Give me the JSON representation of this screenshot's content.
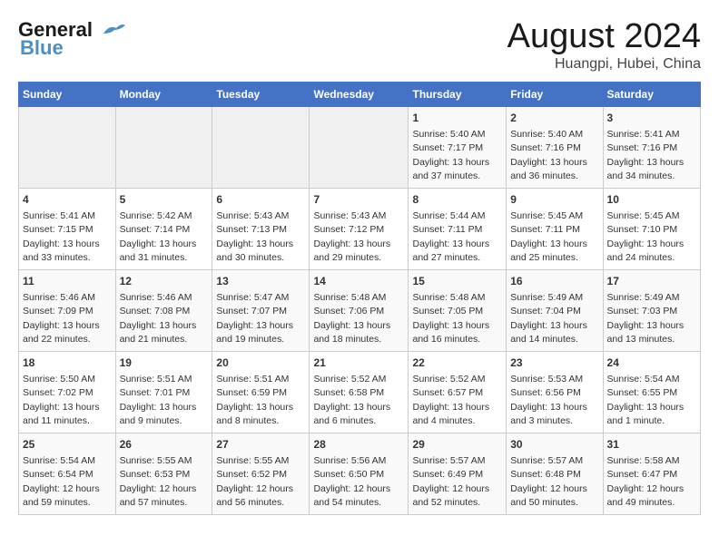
{
  "header": {
    "logo_line1": "General",
    "logo_line2": "Blue",
    "month": "August 2024",
    "location": "Huangpi, Hubei, China"
  },
  "weekdays": [
    "Sunday",
    "Monday",
    "Tuesday",
    "Wednesday",
    "Thursday",
    "Friday",
    "Saturday"
  ],
  "weeks": [
    [
      {
        "day": "",
        "info": ""
      },
      {
        "day": "",
        "info": ""
      },
      {
        "day": "",
        "info": ""
      },
      {
        "day": "",
        "info": ""
      },
      {
        "day": "1",
        "info": "Sunrise: 5:40 AM\nSunset: 7:17 PM\nDaylight: 13 hours and 37 minutes."
      },
      {
        "day": "2",
        "info": "Sunrise: 5:40 AM\nSunset: 7:16 PM\nDaylight: 13 hours and 36 minutes."
      },
      {
        "day": "3",
        "info": "Sunrise: 5:41 AM\nSunset: 7:16 PM\nDaylight: 13 hours and 34 minutes."
      }
    ],
    [
      {
        "day": "4",
        "info": "Sunrise: 5:41 AM\nSunset: 7:15 PM\nDaylight: 13 hours and 33 minutes."
      },
      {
        "day": "5",
        "info": "Sunrise: 5:42 AM\nSunset: 7:14 PM\nDaylight: 13 hours and 31 minutes."
      },
      {
        "day": "6",
        "info": "Sunrise: 5:43 AM\nSunset: 7:13 PM\nDaylight: 13 hours and 30 minutes."
      },
      {
        "day": "7",
        "info": "Sunrise: 5:43 AM\nSunset: 7:12 PM\nDaylight: 13 hours and 29 minutes."
      },
      {
        "day": "8",
        "info": "Sunrise: 5:44 AM\nSunset: 7:11 PM\nDaylight: 13 hours and 27 minutes."
      },
      {
        "day": "9",
        "info": "Sunrise: 5:45 AM\nSunset: 7:11 PM\nDaylight: 13 hours and 25 minutes."
      },
      {
        "day": "10",
        "info": "Sunrise: 5:45 AM\nSunset: 7:10 PM\nDaylight: 13 hours and 24 minutes."
      }
    ],
    [
      {
        "day": "11",
        "info": "Sunrise: 5:46 AM\nSunset: 7:09 PM\nDaylight: 13 hours and 22 minutes."
      },
      {
        "day": "12",
        "info": "Sunrise: 5:46 AM\nSunset: 7:08 PM\nDaylight: 13 hours and 21 minutes."
      },
      {
        "day": "13",
        "info": "Sunrise: 5:47 AM\nSunset: 7:07 PM\nDaylight: 13 hours and 19 minutes."
      },
      {
        "day": "14",
        "info": "Sunrise: 5:48 AM\nSunset: 7:06 PM\nDaylight: 13 hours and 18 minutes."
      },
      {
        "day": "15",
        "info": "Sunrise: 5:48 AM\nSunset: 7:05 PM\nDaylight: 13 hours and 16 minutes."
      },
      {
        "day": "16",
        "info": "Sunrise: 5:49 AM\nSunset: 7:04 PM\nDaylight: 13 hours and 14 minutes."
      },
      {
        "day": "17",
        "info": "Sunrise: 5:49 AM\nSunset: 7:03 PM\nDaylight: 13 hours and 13 minutes."
      }
    ],
    [
      {
        "day": "18",
        "info": "Sunrise: 5:50 AM\nSunset: 7:02 PM\nDaylight: 13 hours and 11 minutes."
      },
      {
        "day": "19",
        "info": "Sunrise: 5:51 AM\nSunset: 7:01 PM\nDaylight: 13 hours and 9 minutes."
      },
      {
        "day": "20",
        "info": "Sunrise: 5:51 AM\nSunset: 6:59 PM\nDaylight: 13 hours and 8 minutes."
      },
      {
        "day": "21",
        "info": "Sunrise: 5:52 AM\nSunset: 6:58 PM\nDaylight: 13 hours and 6 minutes."
      },
      {
        "day": "22",
        "info": "Sunrise: 5:52 AM\nSunset: 6:57 PM\nDaylight: 13 hours and 4 minutes."
      },
      {
        "day": "23",
        "info": "Sunrise: 5:53 AM\nSunset: 6:56 PM\nDaylight: 13 hours and 3 minutes."
      },
      {
        "day": "24",
        "info": "Sunrise: 5:54 AM\nSunset: 6:55 PM\nDaylight: 13 hours and 1 minute."
      }
    ],
    [
      {
        "day": "25",
        "info": "Sunrise: 5:54 AM\nSunset: 6:54 PM\nDaylight: 12 hours and 59 minutes."
      },
      {
        "day": "26",
        "info": "Sunrise: 5:55 AM\nSunset: 6:53 PM\nDaylight: 12 hours and 57 minutes."
      },
      {
        "day": "27",
        "info": "Sunrise: 5:55 AM\nSunset: 6:52 PM\nDaylight: 12 hours and 56 minutes."
      },
      {
        "day": "28",
        "info": "Sunrise: 5:56 AM\nSunset: 6:50 PM\nDaylight: 12 hours and 54 minutes."
      },
      {
        "day": "29",
        "info": "Sunrise: 5:57 AM\nSunset: 6:49 PM\nDaylight: 12 hours and 52 minutes."
      },
      {
        "day": "30",
        "info": "Sunrise: 5:57 AM\nSunset: 6:48 PM\nDaylight: 12 hours and 50 minutes."
      },
      {
        "day": "31",
        "info": "Sunrise: 5:58 AM\nSunset: 6:47 PM\nDaylight: 12 hours and 49 minutes."
      }
    ]
  ]
}
